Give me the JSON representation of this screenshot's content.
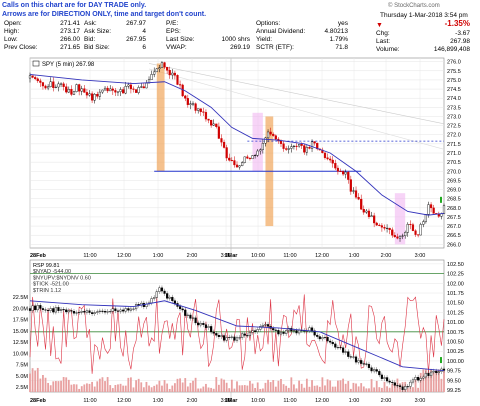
{
  "notes": {
    "line1": "Calls on this chart are for DAY TRADE only.",
    "line2": "Arrows are for DIRECTION ONLY, time and target don't count."
  },
  "header": {
    "datetime": "Thursday  1-Mar-2018  3:54 pm",
    "watermark": "© StockCharts.com",
    "quote": {
      "open": {
        "label": "Open:",
        "value": "271.41"
      },
      "high": {
        "label": "High:",
        "value": "273.17"
      },
      "low": {
        "label": "Low:",
        "value": "266.00"
      },
      "prev_close": {
        "label": "Prev Close:",
        "value": "271.65"
      },
      "ask": {
        "label": "Ask:",
        "value": "267.97"
      },
      "ask_size": {
        "label": "Ask Size:",
        "value": "4"
      },
      "bid": {
        "label": "Bid:",
        "value": "267.95"
      },
      "bid_size": {
        "label": "Bid Size:",
        "value": "6"
      },
      "pe": {
        "label": "P/E:",
        "value": ""
      },
      "eps": {
        "label": "EPS:",
        "value": ""
      },
      "last_size": {
        "label": "Last Size:",
        "value": "1000 shrs"
      },
      "vwap": {
        "label": "VWAP:",
        "value": "269.19"
      },
      "options": {
        "label": "Options:",
        "value": "yes"
      },
      "annual_dividend": {
        "label": "Annual Dividend:",
        "value": "4.80213"
      },
      "yield": {
        "label": "Yield:",
        "value": "1.79%"
      },
      "sctr": {
        "label": "SCTR (ETF):",
        "value": "71.8"
      },
      "change_pct": {
        "value": "-1.35%"
      },
      "chg": {
        "label": "Chg:",
        "value": "-3.67"
      },
      "last": {
        "label": "Last:",
        "value": "267.98"
      },
      "volume": {
        "label": "Volume:",
        "value": "146,899,408"
      }
    }
  },
  "colors": {
    "up": "#000000",
    "down": "#d00000",
    "ma": "#3333bb",
    "orange": "#f0a050",
    "pink": "#f0b0f0",
    "level": "#2233cc",
    "green_line": "#3a8a3a",
    "rsp_red": "#dd3344",
    "vol": "#e8a0a0"
  },
  "chart_data": [
    {
      "type": "candlestick",
      "legend": "SPY (5 min) 267.98",
      "ylim": [
        265.8,
        276.2
      ],
      "y_ticks": [
        "276.0",
        "275.5",
        "275.0",
        "274.5",
        "274.0",
        "273.5",
        "273.0",
        "272.5",
        "272.0",
        "271.5",
        "271.0",
        "270.5",
        "270.0",
        "269.5",
        "269.0",
        "268.5",
        "268.0",
        "267.5",
        "267.0",
        "266.5",
        "266.0"
      ],
      "x_ticks": [
        "28Feb",
        "11:00",
        "12:00",
        "1:00",
        "2:00",
        "3:00",
        "1Mar",
        "10:00",
        "11:00",
        "12:00",
        "1:00",
        "2:00",
        "3:00"
      ],
      "close_path": [
        [
          0,
          275.1
        ],
        [
          2,
          275.0
        ],
        [
          4,
          274.9
        ],
        [
          6,
          274.5
        ],
        [
          8,
          274.8
        ],
        [
          10,
          274.6
        ],
        [
          12,
          274.7
        ],
        [
          14,
          274.5
        ],
        [
          16,
          274.3
        ],
        [
          18,
          274.6
        ],
        [
          20,
          274.4
        ],
        [
          22,
          274.2
        ],
        [
          24,
          274.0
        ],
        [
          26,
          274.1
        ],
        [
          28,
          274.3
        ],
        [
          30,
          274.5
        ],
        [
          32,
          274.3
        ],
        [
          34,
          274.2
        ],
        [
          36,
          274.4
        ],
        [
          38,
          274.6
        ],
        [
          40,
          274.3
        ],
        [
          42,
          274.5
        ],
        [
          44,
          274.7
        ],
        [
          46,
          275.0
        ],
        [
          48,
          275.4
        ],
        [
          50,
          275.8
        ],
        [
          51,
          276.0
        ],
        [
          52,
          275.6
        ],
        [
          54,
          275.4
        ],
        [
          56,
          275.1
        ],
        [
          58,
          274.6
        ],
        [
          60,
          274.0
        ],
        [
          62,
          273.6
        ],
        [
          64,
          273.5
        ],
        [
          66,
          273.2
        ],
        [
          68,
          273.0
        ],
        [
          70,
          272.6
        ],
        [
          72,
          272.3
        ],
        [
          74,
          271.6
        ],
        [
          76,
          270.9
        ],
        [
          78,
          270.6
        ],
        [
          80,
          270.4
        ],
        [
          82,
          270.5
        ],
        [
          84,
          270.8
        ],
        [
          86,
          270.9
        ],
        [
          88,
          271.2
        ],
        [
          90,
          271.4
        ],
        [
          91,
          271.8
        ],
        [
          92,
          272.3
        ],
        [
          94,
          271.9
        ],
        [
          96,
          271.5
        ],
        [
          98,
          271.3
        ],
        [
          100,
          271.4
        ],
        [
          102,
          271.3
        ],
        [
          104,
          271.5
        ],
        [
          106,
          271.2
        ],
        [
          108,
          271.4
        ],
        [
          110,
          271.6
        ],
        [
          112,
          271.2
        ],
        [
          114,
          270.9
        ],
        [
          116,
          270.6
        ],
        [
          118,
          270.2
        ],
        [
          120,
          270.0
        ],
        [
          122,
          269.8
        ],
        [
          124,
          269.0
        ],
        [
          126,
          268.6
        ],
        [
          128,
          268.0
        ],
        [
          130,
          267.8
        ],
        [
          132,
          267.4
        ],
        [
          134,
          267.2
        ],
        [
          136,
          267.0
        ],
        [
          138,
          266.8
        ],
        [
          140,
          266.6
        ],
        [
          142,
          266.2
        ],
        [
          144,
          266.4
        ],
        [
          146,
          267.2
        ],
        [
          148,
          266.8
        ],
        [
          150,
          266.6
        ],
        [
          152,
          267.3
        ],
        [
          154,
          268.2
        ],
        [
          156,
          267.8
        ],
        [
          158,
          267.5
        ],
        [
          160,
          267.98
        ]
      ],
      "moving_average": [
        [
          0,
          275.3
        ],
        [
          20,
          275.0
        ],
        [
          40,
          274.8
        ],
        [
          52,
          274.9
        ],
        [
          60,
          274.4
        ],
        [
          70,
          273.5
        ],
        [
          78,
          272.4
        ],
        [
          86,
          271.8
        ],
        [
          96,
          271.7
        ],
        [
          106,
          271.5
        ],
        [
          116,
          271.0
        ],
        [
          126,
          270.0
        ],
        [
          136,
          268.7
        ],
        [
          146,
          267.8
        ],
        [
          154,
          267.6
        ],
        [
          160,
          267.7
        ]
      ],
      "horizontal_levels": [
        {
          "value": 271.65,
          "style": "dotted",
          "label": "Prev Close"
        },
        {
          "value": 270.0,
          "style": "solid",
          "label": ""
        }
      ],
      "highlight_boxes": [
        {
          "color": "orange",
          "x": [
            49,
            52
          ],
          "y": [
            270.0,
            275.9
          ]
        },
        {
          "color": "pink",
          "x": [
            86,
            90
          ],
          "y": [
            270.0,
            273.2
          ]
        },
        {
          "color": "orange",
          "x": [
            91,
            94
          ],
          "y": [
            267.0,
            273.0
          ]
        },
        {
          "color": "pink",
          "x": [
            141,
            145
          ],
          "y": [
            266.0,
            268.8
          ]
        }
      ]
    },
    {
      "type": "multi_line",
      "legend": [
        "RSP 99.81",
        "$NYAD -544.00",
        "$NYUPV:$NYDNV 0.60",
        "$TICK -521.00",
        "$TRIN 1.12"
      ],
      "left_ticks": [
        "22.5M",
        "20.0M",
        "17.5M",
        "15.0M",
        "12.5M",
        "10.0M",
        "7.5M",
        "5.0M",
        "2.5M"
      ],
      "right_ticks": [
        "102.50",
        "102.25",
        "102.00",
        "101.75",
        "101.50",
        "101.25",
        "101.00",
        "100.75",
        "100.50",
        "100.25",
        "100.00",
        "99.75",
        "99.50",
        "99.25"
      ],
      "ylim_right": [
        99.2,
        102.6
      ],
      "horizontal_levels": [
        {
          "value": 102.25,
          "color": "green_line"
        },
        {
          "value": 100.75,
          "color": "green_line"
        }
      ],
      "rsp_price": [
        [
          0,
          101.35
        ],
        [
          4,
          101.4
        ],
        [
          8,
          101.3
        ],
        [
          12,
          101.35
        ],
        [
          16,
          101.25
        ],
        [
          20,
          101.3
        ],
        [
          24,
          101.25
        ],
        [
          28,
          101.3
        ],
        [
          32,
          101.35
        ],
        [
          36,
          101.3
        ],
        [
          40,
          101.4
        ],
        [
          44,
          101.45
        ],
        [
          48,
          101.6
        ],
        [
          50,
          101.85
        ],
        [
          52,
          101.7
        ],
        [
          56,
          101.5
        ],
        [
          60,
          101.2
        ],
        [
          64,
          101.0
        ],
        [
          68,
          100.9
        ],
        [
          72,
          100.7
        ],
        [
          76,
          100.55
        ],
        [
          80,
          100.6
        ],
        [
          84,
          100.7
        ],
        [
          88,
          100.85
        ],
        [
          92,
          100.95
        ],
        [
          96,
          100.7
        ],
        [
          100,
          100.8
        ],
        [
          104,
          100.75
        ],
        [
          108,
          100.8
        ],
        [
          112,
          100.6
        ],
        [
          116,
          100.5
        ],
        [
          120,
          100.3
        ],
        [
          124,
          100.1
        ],
        [
          128,
          99.95
        ],
        [
          132,
          99.8
        ],
        [
          136,
          99.6
        ],
        [
          140,
          99.45
        ],
        [
          144,
          99.3
        ],
        [
          148,
          99.5
        ],
        [
          152,
          99.6
        ],
        [
          156,
          99.7
        ],
        [
          160,
          99.81
        ]
      ],
      "ma": [
        [
          0,
          101.55
        ],
        [
          20,
          101.45
        ],
        [
          40,
          101.4
        ],
        [
          52,
          101.55
        ],
        [
          64,
          101.3
        ],
        [
          80,
          100.9
        ],
        [
          96,
          100.85
        ],
        [
          112,
          100.75
        ],
        [
          128,
          100.3
        ],
        [
          144,
          99.85
        ],
        [
          160,
          99.75
        ]
      ]
    }
  ]
}
